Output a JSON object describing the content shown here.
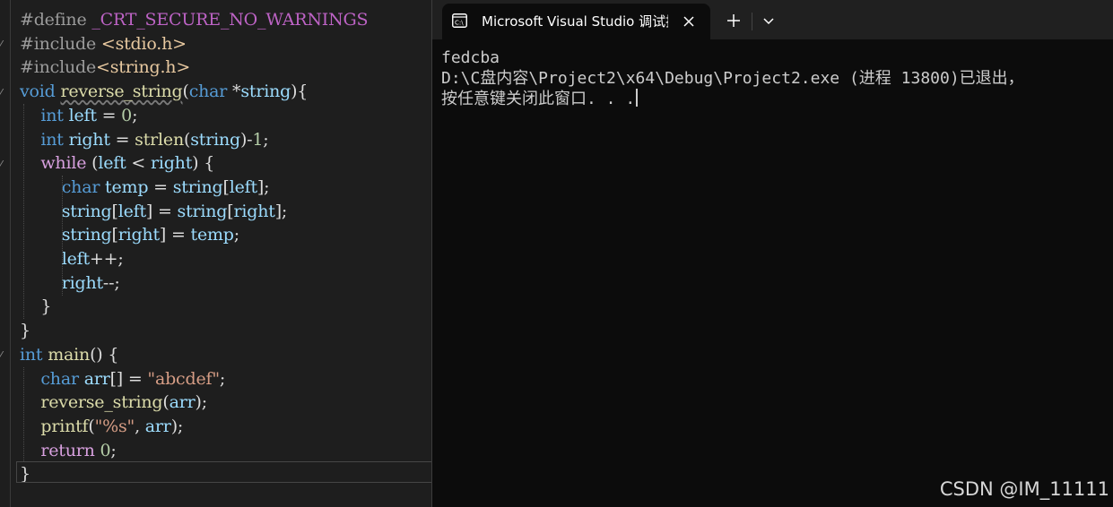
{
  "editor": {
    "lines": [
      {
        "tokens": [
          [
            "pp",
            "#define "
          ],
          [
            "mac",
            "_CRT_SECURE_NO_WARNINGS"
          ]
        ]
      },
      {
        "tokens": [
          [
            "pp",
            "#include "
          ],
          [
            "inc",
            "<stdio.h>"
          ]
        ]
      },
      {
        "tokens": [
          [
            "pp",
            "#include"
          ],
          [
            "inc",
            "<string.h>"
          ]
        ]
      },
      {
        "tokens": [
          [
            "kw",
            "void "
          ],
          [
            "fn squig",
            "reverse_string"
          ],
          [
            "plain",
            "("
          ],
          [
            "kw",
            "char "
          ],
          [
            "plain",
            "*"
          ],
          [
            "var",
            "string"
          ],
          [
            "plain",
            "){"
          ]
        ]
      },
      {
        "tokens": [
          [
            "plain",
            "    "
          ],
          [
            "kw",
            "int "
          ],
          [
            "var",
            "left"
          ],
          [
            "plain",
            " = "
          ],
          [
            "num",
            "0"
          ],
          [
            "plain",
            ";"
          ]
        ]
      },
      {
        "tokens": [
          [
            "plain",
            "    "
          ],
          [
            "kw",
            "int "
          ],
          [
            "var",
            "right"
          ],
          [
            "plain",
            " = "
          ],
          [
            "fn",
            "strlen"
          ],
          [
            "plain",
            "("
          ],
          [
            "var",
            "string"
          ],
          [
            "plain",
            ")-"
          ],
          [
            "num",
            "1"
          ],
          [
            "plain",
            ";"
          ]
        ]
      },
      {
        "tokens": [
          [
            "plain",
            "    "
          ],
          [
            "ctl",
            "while "
          ],
          [
            "plain",
            "("
          ],
          [
            "var",
            "left"
          ],
          [
            "plain",
            " < "
          ],
          [
            "var",
            "right"
          ],
          [
            "plain",
            ") {"
          ]
        ]
      },
      {
        "tokens": [
          [
            "plain",
            "        "
          ],
          [
            "kw",
            "char "
          ],
          [
            "var",
            "temp"
          ],
          [
            "plain",
            " = "
          ],
          [
            "var",
            "string"
          ],
          [
            "plain",
            "["
          ],
          [
            "var",
            "left"
          ],
          [
            "plain",
            "];"
          ]
        ]
      },
      {
        "tokens": [
          [
            "plain",
            "        "
          ],
          [
            "var",
            "string"
          ],
          [
            "plain",
            "["
          ],
          [
            "var",
            "left"
          ],
          [
            "plain",
            "] = "
          ],
          [
            "var",
            "string"
          ],
          [
            "plain",
            "["
          ],
          [
            "var",
            "right"
          ],
          [
            "plain",
            "];"
          ]
        ]
      },
      {
        "tokens": [
          [
            "plain",
            "        "
          ],
          [
            "var",
            "string"
          ],
          [
            "plain",
            "["
          ],
          [
            "var",
            "right"
          ],
          [
            "plain",
            "] = "
          ],
          [
            "var",
            "temp"
          ],
          [
            "plain",
            ";"
          ]
        ]
      },
      {
        "tokens": [
          [
            "plain",
            "        "
          ],
          [
            "var",
            "left"
          ],
          [
            "plain",
            "++;"
          ]
        ]
      },
      {
        "tokens": [
          [
            "plain",
            "        "
          ],
          [
            "var",
            "right"
          ],
          [
            "plain",
            "--;"
          ]
        ]
      },
      {
        "tokens": [
          [
            "plain",
            "    }"
          ]
        ]
      },
      {
        "tokens": [
          [
            "plain",
            "}"
          ]
        ]
      },
      {
        "tokens": [
          [
            "kw",
            "int "
          ],
          [
            "fn",
            "main"
          ],
          [
            "plain",
            "() {"
          ]
        ]
      },
      {
        "tokens": [
          [
            "plain",
            "    "
          ],
          [
            "kw",
            "char "
          ],
          [
            "var",
            "arr"
          ],
          [
            "plain",
            "[] = "
          ],
          [
            "str",
            "\"abcdef\""
          ],
          [
            "plain",
            ";"
          ]
        ]
      },
      {
        "tokens": [
          [
            "plain",
            "    "
          ],
          [
            "fn",
            "reverse_string"
          ],
          [
            "plain",
            "("
          ],
          [
            "var",
            "arr"
          ],
          [
            "plain",
            ");"
          ]
        ]
      },
      {
        "tokens": [
          [
            "plain",
            "    "
          ],
          [
            "fn",
            "printf"
          ],
          [
            "plain",
            "("
          ],
          [
            "str",
            "\"%s\""
          ],
          [
            "plain",
            ", "
          ],
          [
            "var",
            "arr"
          ],
          [
            "plain",
            ");"
          ]
        ]
      },
      {
        "tokens": [
          [
            "plain",
            "    "
          ],
          [
            "ctl",
            "return "
          ],
          [
            "num",
            "0"
          ],
          [
            "plain",
            ";"
          ]
        ]
      },
      {
        "tokens": [
          [
            "plain",
            "}"
          ]
        ]
      }
    ]
  },
  "terminal": {
    "tab_title": "Microsoft Visual Studio 调试控制台",
    "icon": "console-icon",
    "close_icon": "close-icon",
    "new_tab_icon": "plus-icon",
    "dropdown_icon": "chevron-down-icon",
    "output": [
      "fedcba",
      "D:\\C盘内容\\Project2\\x64\\Debug\\Project2.exe (进程 13800)已退出，",
      "按任意键关闭此窗口. . ."
    ]
  },
  "watermark": "CSDN @IM_11111",
  "colors": {
    "editor_bg": "#1e1e1e",
    "terminal_bg": "#0c0c0c",
    "tabbar_bg": "#202020",
    "keyword": "#569cd6",
    "control": "#d8a0df",
    "function": "#dcdcaa",
    "variable": "#9cdcfe",
    "string": "#d69d85",
    "number": "#b5cea8"
  }
}
